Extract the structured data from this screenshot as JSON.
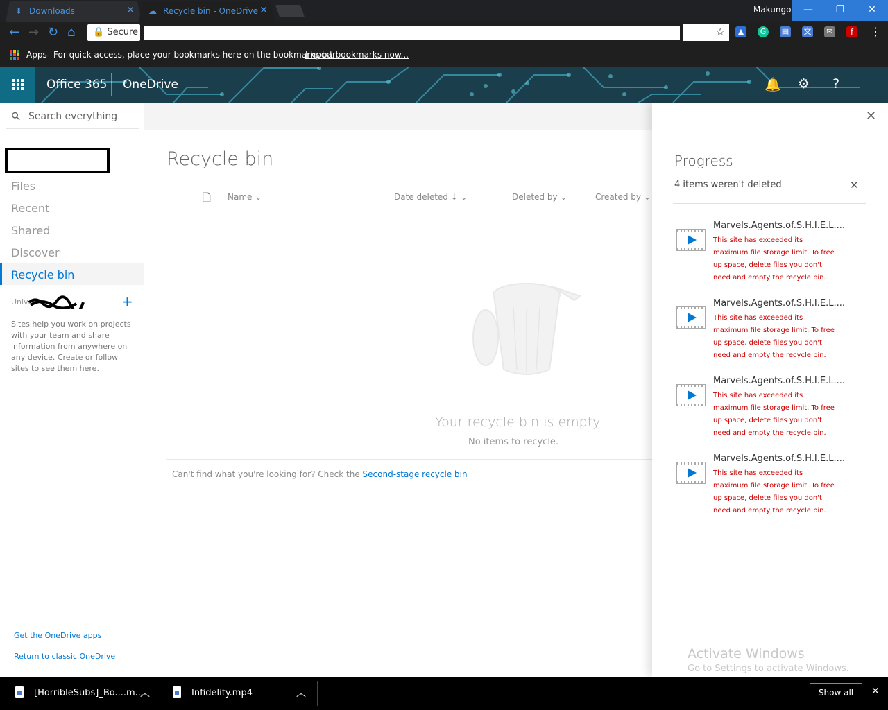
{
  "browser": {
    "tabs": [
      {
        "title": "Downloads",
        "icon": "download-icon",
        "active": false
      },
      {
        "title": "Recycle bin - OneDrive",
        "icon": "onedrive-cloud-icon",
        "active": true
      }
    ],
    "profile_name": "Makungo",
    "secure_label": "Secure",
    "url": "",
    "bookmarks": {
      "apps_label": "Apps",
      "hint": "For quick access, place your bookmarks here on the bookmarks bar.",
      "import_link": "Import bookmarks now..."
    },
    "window_controls": {
      "minimize": "—",
      "restore": "❐",
      "close": "✕"
    }
  },
  "o365_header": {
    "suite_label": "Office 365",
    "app_label": "OneDrive",
    "icons": [
      "bell-icon",
      "settings-gear-icon",
      "help-icon"
    ]
  },
  "sidebar": {
    "search_placeholder": "Search everything",
    "items": [
      {
        "label": "Files"
      },
      {
        "label": "Recent"
      },
      {
        "label": "Shared"
      },
      {
        "label": "Discover"
      },
      {
        "label": "Recycle bin",
        "selected": true
      }
    ],
    "sites_group_label": "Unive",
    "sites_help": "Sites help you work on projects with your team and share information from anywhere on any device. Create or follow sites to see them here.",
    "footer_links": [
      "Get the OneDrive apps",
      "Return to classic OneDrive"
    ]
  },
  "main": {
    "title": "Recycle bin",
    "columns": [
      "Name",
      "Date deleted",
      "Deleted by",
      "Created by"
    ],
    "sort_indicator": "↓",
    "empty_title": "Your recycle bin is empty",
    "empty_sub": "No items to recycle.",
    "cant_find_text": "Can't find what you're looking for? Check the",
    "second_stage_link": "Second-stage recycle bin"
  },
  "progress_panel": {
    "title": "Progress",
    "summary": "4 items weren't deleted",
    "items": [
      {
        "name": "Marvels.Agents.of.S.H.I.E.L....",
        "error": "This site has exceeded its maximum file storage limit. To free up space, delete files you don't need and empty the recycle bin."
      },
      {
        "name": "Marvels.Agents.of.S.H.I.E.L....",
        "error": "This site has exceeded its maximum file storage limit. To free up space, delete files you don't need and empty the recycle bin."
      },
      {
        "name": "Marvels.Agents.of.S.H.I.E.L....",
        "error": "This site has exceeded its maximum file storage limit. To free up space, delete files you don't need and empty the recycle bin."
      },
      {
        "name": "Marvels.Agents.of.S.H.I.E.L....",
        "error": "This site has exceeded its maximum file storage limit. To free up space, delete files you don't need and empty the recycle bin."
      }
    ]
  },
  "watermark": {
    "line1": "Activate Windows",
    "line2": "Go to Settings to activate Windows."
  },
  "downloads_bar": {
    "items": [
      {
        "name": "[HorribleSubs]_Bo....m..."
      },
      {
        "name": "Infidelity.mp4"
      }
    ],
    "show_all": "Show all"
  },
  "colors": {
    "accent": "#0078d4",
    "error": "#cc0000",
    "chrome_blue": "#4a90d9",
    "header_bg": "#1b3e4d"
  }
}
